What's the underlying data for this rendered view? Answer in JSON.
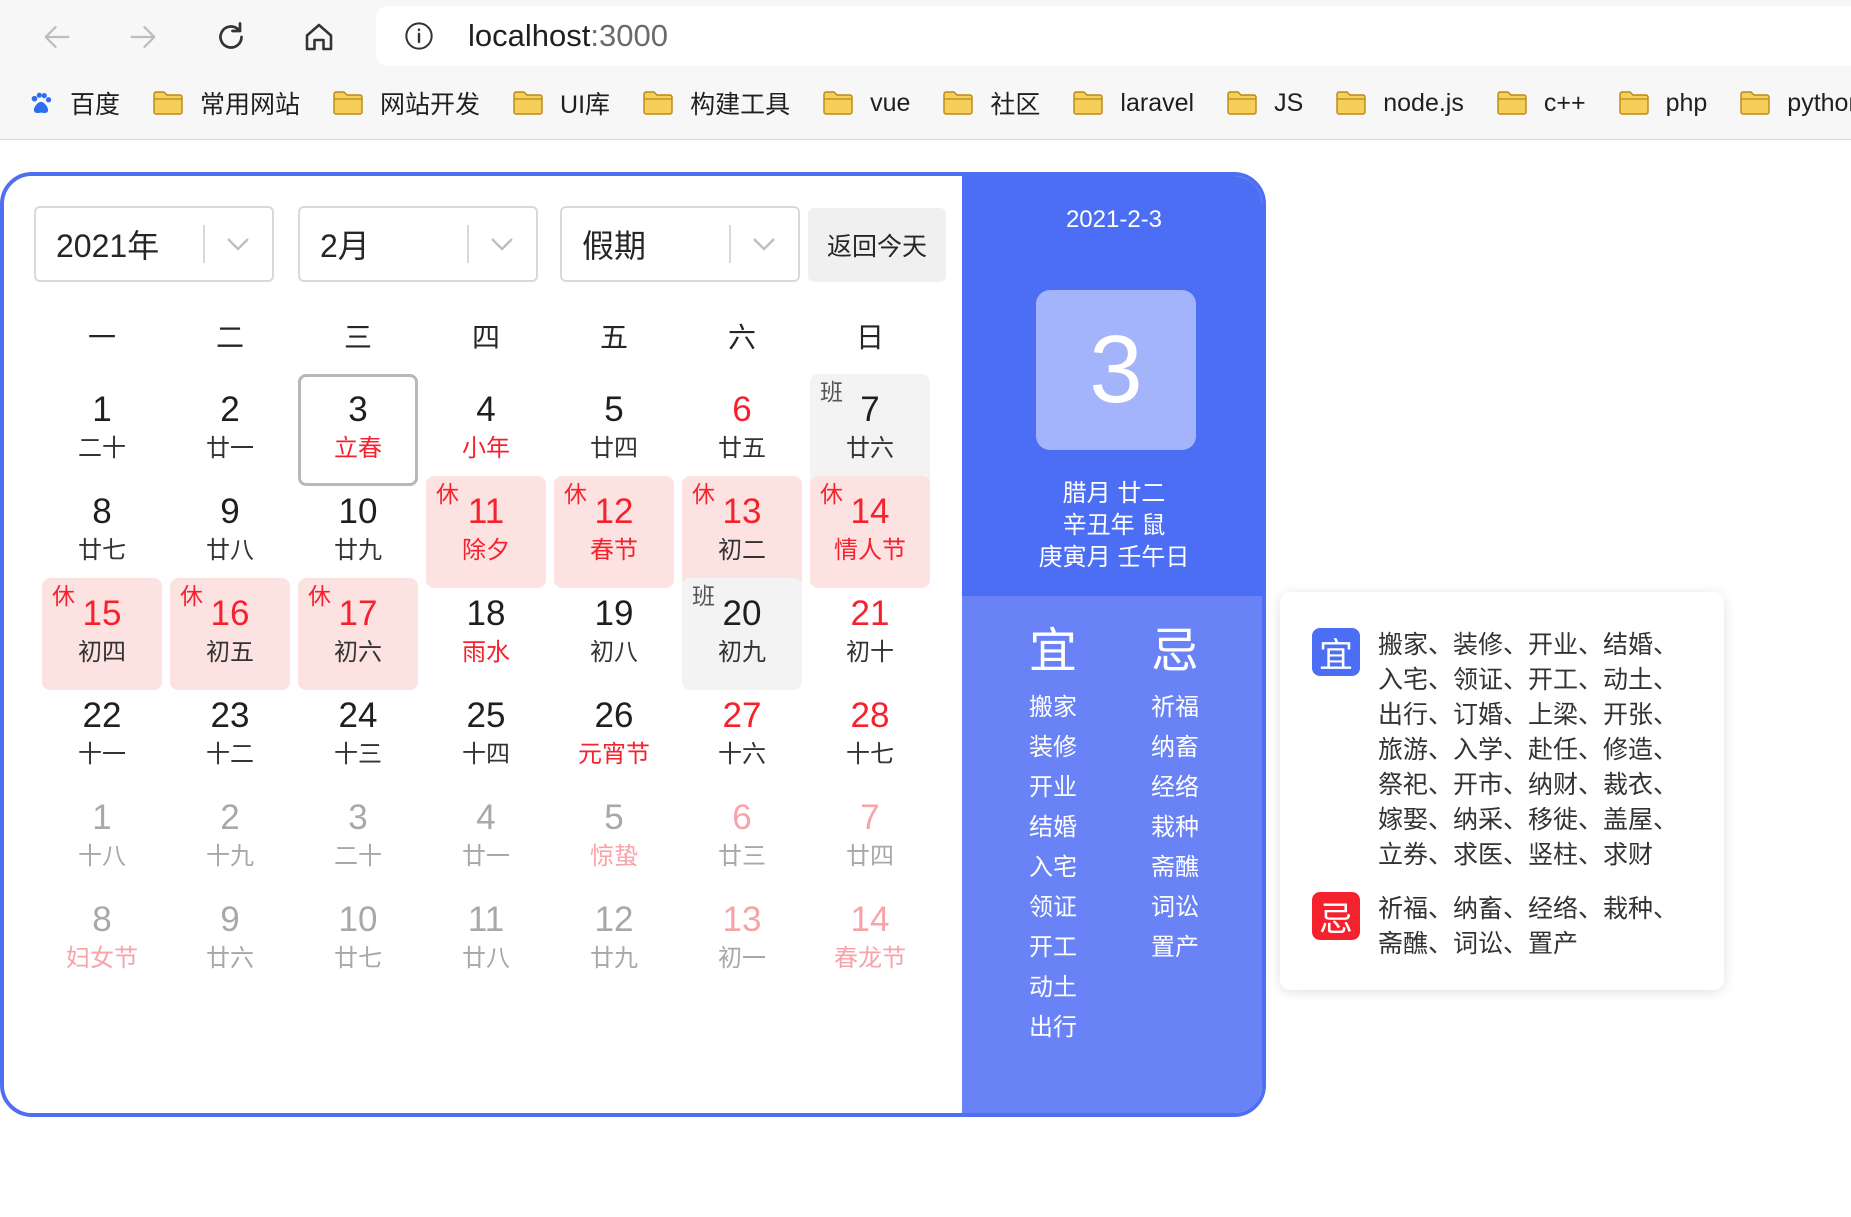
{
  "browser": {
    "url_host": "localhost",
    "url_port": ":3000",
    "bookmarks": [
      {
        "label": "百度",
        "icon": "baidu-icon"
      },
      {
        "label": "常用网站",
        "icon": "folder-icon"
      },
      {
        "label": "网站开发",
        "icon": "folder-icon"
      },
      {
        "label": "UI库",
        "icon": "folder-icon"
      },
      {
        "label": "构建工具",
        "icon": "folder-icon"
      },
      {
        "label": "vue",
        "icon": "folder-icon"
      },
      {
        "label": "社区",
        "icon": "folder-icon"
      },
      {
        "label": "laravel",
        "icon": "folder-icon"
      },
      {
        "label": "JS",
        "icon": "folder-icon"
      },
      {
        "label": "node.js",
        "icon": "folder-icon"
      },
      {
        "label": "c++",
        "icon": "folder-icon"
      },
      {
        "label": "php",
        "icon": "folder-icon"
      },
      {
        "label": "python",
        "icon": "folder-icon"
      }
    ]
  },
  "controls": {
    "year": "2021年",
    "month": "2月",
    "holiday": "假期",
    "today_button": "返回今天"
  },
  "weekdays": [
    "一",
    "二",
    "三",
    "四",
    "五",
    "六",
    "日"
  ],
  "days": [
    {
      "num": "1",
      "lunar": "二十"
    },
    {
      "num": "2",
      "lunar": "廿一"
    },
    {
      "num": "3",
      "lunar": "立春",
      "lunar_red": true,
      "selected": true
    },
    {
      "num": "4",
      "lunar": "小年",
      "lunar_red": true
    },
    {
      "num": "5",
      "lunar": "廿四"
    },
    {
      "num": "6",
      "lunar": "廿五",
      "num_red": true
    },
    {
      "num": "7",
      "lunar": "廿六",
      "type": "work",
      "tag": "班"
    },
    {
      "num": "8",
      "lunar": "廿七"
    },
    {
      "num": "9",
      "lunar": "廿八"
    },
    {
      "num": "10",
      "lunar": "廿九"
    },
    {
      "num": "11",
      "lunar": "除夕",
      "type": "rest",
      "tag": "休",
      "num_red": true,
      "lunar_red": true
    },
    {
      "num": "12",
      "lunar": "春节",
      "type": "rest",
      "tag": "休",
      "num_red": true,
      "lunar_red": true
    },
    {
      "num": "13",
      "lunar": "初二",
      "type": "rest",
      "tag": "休",
      "num_red": true
    },
    {
      "num": "14",
      "lunar": "情人节",
      "type": "rest",
      "tag": "休",
      "num_red": true,
      "lunar_red": true
    },
    {
      "num": "15",
      "lunar": "初四",
      "type": "rest",
      "tag": "休",
      "num_red": true
    },
    {
      "num": "16",
      "lunar": "初五",
      "type": "rest",
      "tag": "休",
      "num_red": true
    },
    {
      "num": "17",
      "lunar": "初六",
      "type": "rest",
      "tag": "休",
      "num_red": true
    },
    {
      "num": "18",
      "lunar": "雨水",
      "lunar_red": true
    },
    {
      "num": "19",
      "lunar": "初八"
    },
    {
      "num": "20",
      "lunar": "初九",
      "type": "work",
      "tag": "班"
    },
    {
      "num": "21",
      "lunar": "初十",
      "num_red": true
    },
    {
      "num": "22",
      "lunar": "十一"
    },
    {
      "num": "23",
      "lunar": "十二"
    },
    {
      "num": "24",
      "lunar": "十三"
    },
    {
      "num": "25",
      "lunar": "十四"
    },
    {
      "num": "26",
      "lunar": "元宵节",
      "lunar_red": true
    },
    {
      "num": "27",
      "lunar": "十六",
      "num_red": true
    },
    {
      "num": "28",
      "lunar": "十七",
      "num_red": true
    },
    {
      "num": "1",
      "lunar": "十八",
      "other": true
    },
    {
      "num": "2",
      "lunar": "十九",
      "other": true
    },
    {
      "num": "3",
      "lunar": "二十",
      "other": true
    },
    {
      "num": "4",
      "lunar": "廿一",
      "other": true
    },
    {
      "num": "5",
      "lunar": "惊蛰",
      "other": true,
      "lunar_red": true
    },
    {
      "num": "6",
      "lunar": "廿三",
      "other": true,
      "num_red": true
    },
    {
      "num": "7",
      "lunar": "廿四",
      "other": true,
      "num_red": true
    },
    {
      "num": "8",
      "lunar": "妇女节",
      "other": true,
      "lunar_red": true
    },
    {
      "num": "9",
      "lunar": "廿六",
      "other": true
    },
    {
      "num": "10",
      "lunar": "廿七",
      "other": true
    },
    {
      "num": "11",
      "lunar": "廿八",
      "other": true
    },
    {
      "num": "12",
      "lunar": "廿九",
      "other": true
    },
    {
      "num": "13",
      "lunar": "初一",
      "other": true,
      "num_red": true
    },
    {
      "num": "14",
      "lunar": "春龙节",
      "other": true,
      "num_red": true,
      "lunar_red": true
    }
  ],
  "detail": {
    "date": "2021-2-3",
    "day": "3",
    "lunar_lines": [
      "腊月 廿二",
      "辛丑年 鼠",
      "庚寅月 壬午日"
    ],
    "yi_label": "宜",
    "ji_label": "忌",
    "yi": [
      "搬家",
      "装修",
      "开业",
      "结婚",
      "入宅",
      "领证",
      "开工",
      "动土",
      "出行"
    ],
    "ji": [
      "祈福",
      "纳畜",
      "经络",
      "栽种",
      "斋醮",
      "词讼",
      "置产"
    ]
  },
  "popup": {
    "yi_label": "宜",
    "ji_label": "忌",
    "yi_lines": [
      "搬家、装修、开业、结婚、",
      "入宅、领证、开工、动土、",
      "出行、订婚、上梁、开张、",
      "旅游、入学、赴任、修造、",
      "祭祀、开市、纳财、裁衣、",
      "嫁娶、纳采、移徙、盖屋、",
      "立券、求医、竖柱、求财"
    ],
    "ji_lines": [
      "祈福、纳畜、经络、栽种、",
      "斋醮、词讼、置产"
    ]
  },
  "colors": {
    "accent": "#4c6ef5",
    "accent_light": "#6983f6",
    "holiday_red": "#f5222d",
    "rest_bg": "#fde2e2",
    "work_bg": "#f3f3f3"
  }
}
